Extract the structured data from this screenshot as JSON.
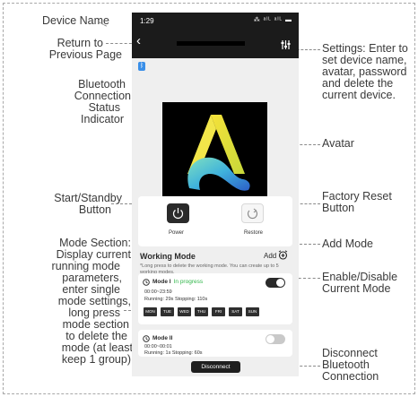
{
  "annotations": {
    "device_name": "Device Name",
    "return_1": "Return to",
    "return_2": "Previous Page",
    "bt_1": "Bluetooth",
    "bt_2": "Connection",
    "bt_3": "Status",
    "bt_4": "Indicator",
    "start_1": "Start/Standby",
    "start_2": "Button",
    "mode_1": "Mode Section:",
    "mode_2": "Display current",
    "mode_3": "running mode",
    "mode_4": "parameters,",
    "mode_5": "enter single",
    "mode_6": "mode settings,",
    "mode_7": "long press",
    "mode_8": "mode section",
    "mode_9": "to delete the",
    "mode_10": "mode (at least",
    "mode_11": "keep 1 group)",
    "settings_1": "Settings: Enter to",
    "settings_2": "set device name,",
    "settings_3": "avatar, password",
    "settings_4": "and delete the",
    "settings_5": "current device.",
    "avatar": "Avatar",
    "reset_1": "Factory Reset",
    "reset_2": "Button",
    "add_mode": "Add Mode",
    "enable_1": "Enable/Disable",
    "enable_2": "Current Mode",
    "disc_1": "Disconnect",
    "disc_2": "Bluetooth",
    "disc_3": "Connection"
  },
  "phone": {
    "status_time": "1:29",
    "status_icons": "⁂ ᵃᴵᴸ ᵃᴵᴸ ▬",
    "back_icon": "chevron-left-icon",
    "bluetooth_glyph": "ᛒ",
    "power_label": "Power",
    "restore_label": "Restore",
    "working_mode_title": "Working Mode",
    "add_label": "Add",
    "hint": "*Long press to delete the working mode. You can create up to 5 working modes.",
    "modes": [
      {
        "name": "Mode I",
        "status": "In progress",
        "time": "00:00~23:59",
        "cycle": "Running:  29s  Stopping:  110s",
        "enabled": true,
        "days": [
          "MON",
          "TUE",
          "WED",
          "THU",
          "FRI",
          "SAT",
          "SUN"
        ]
      },
      {
        "name": "Mode II",
        "status": "",
        "time": "00:00~00:01",
        "cycle": "Running:  1s  Stopping:  60s",
        "enabled": false,
        "days": []
      }
    ],
    "disconnect_label": "Disconnect"
  },
  "colors": {
    "topbar": "#1b1b1b",
    "accent_green": "#2fb548",
    "toggle_on": "#2a2a2a",
    "toggle_off": "#c9c9c9",
    "bluetooth_blue": "#3a8fe8"
  }
}
